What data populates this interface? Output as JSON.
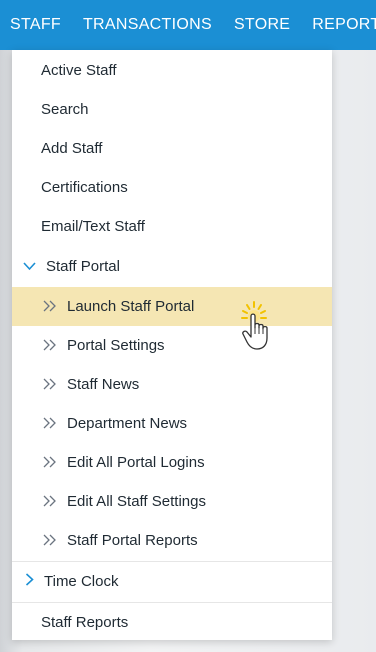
{
  "nav": {
    "items": [
      "STAFF",
      "TRANSACTIONS",
      "STORE",
      "REPORTS"
    ]
  },
  "menu": {
    "items": [
      {
        "label": "Active Staff"
      },
      {
        "label": "Search"
      },
      {
        "label": "Add Staff"
      },
      {
        "label": "Certifications"
      },
      {
        "label": "Email/Text Staff"
      }
    ],
    "staff_portal": {
      "label": "Staff Portal",
      "subitems": [
        {
          "label": "Launch Staff Portal"
        },
        {
          "label": "Portal Settings"
        },
        {
          "label": "Staff News"
        },
        {
          "label": "Department News"
        },
        {
          "label": "Edit All Portal Logins"
        },
        {
          "label": "Edit All Staff Settings"
        },
        {
          "label": "Staff Portal Reports"
        }
      ]
    },
    "time_clock": {
      "label": "Time Clock"
    },
    "staff_reports": {
      "label": "Staff Reports"
    }
  },
  "colors": {
    "accent": "#1b8fd4",
    "highlight": "#f5e6b3"
  }
}
